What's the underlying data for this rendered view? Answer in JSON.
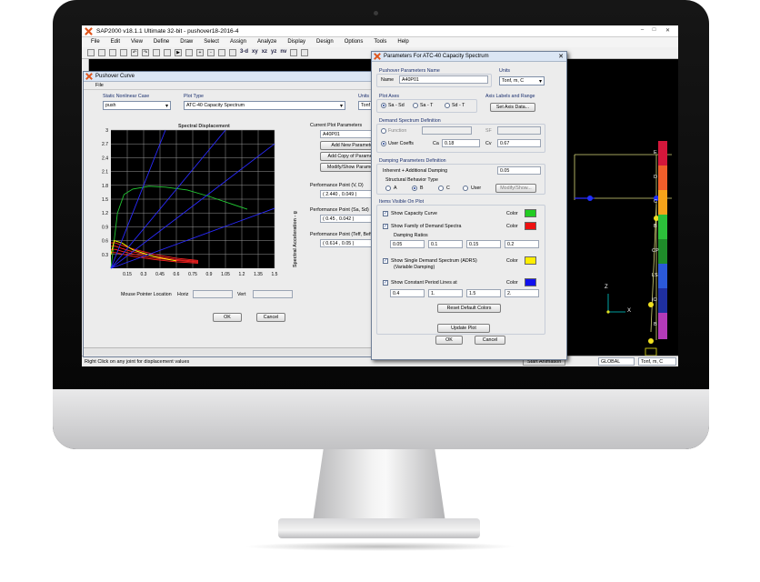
{
  "app": {
    "title": "SAP2000 v18.1.1 Ultimate 32-bit - pushover18-2016-4",
    "menu": [
      "File",
      "Edit",
      "View",
      "Define",
      "Draw",
      "Select",
      "Assign",
      "Analyze",
      "Display",
      "Design",
      "Options",
      "Tools",
      "Help"
    ],
    "toolbar_text": [
      "3-d",
      "xy",
      "xz",
      "yz",
      "nv"
    ],
    "status_text": "Right Click on any joint for displacement values",
    "status_animation": "Start Animation",
    "status_global": "GLOBAL",
    "status_units": "Tonf, m, C"
  },
  "pushover_curve": {
    "title": "Pushover Curve",
    "menu_file": "File",
    "case_label": "Static Nonlinear Case",
    "case_value": "push",
    "plot_type_label": "Plot Type",
    "plot_type_value": "ATC-40 Capacity Spectrum",
    "units_label": "Units",
    "units_value": "Tonf",
    "chart_title": "Spectral Displacement",
    "ylabel": "Spectral Acceleration - g",
    "current_params_label": "Current Plot Parameters",
    "current_params_value": "A40P01",
    "add_new_btn": "Add New Parameters",
    "add_copy_btn": "Add Copy of Parameters",
    "modify_btn": "Modify/Show Parameters",
    "perf_v_label": "Performance Point (V, D)",
    "perf_v_value": "( 2.440 , 0.049 )",
    "perf_sa_label": "Performance Point (Sa, Sd)",
    "perf_sa_value": "( 0.45 , 0.042 )",
    "perf_t_label": "Performance Point (Teff, Beff)",
    "perf_t_value": "( 0.614 , 0.05 )",
    "mouse_label": "Mouse Pointer Location",
    "horiz_label": "Horiz",
    "vert_label": "Vert",
    "ok": "OK",
    "cancel": "Cancel"
  },
  "chart_data": {
    "type": "line",
    "title": "Spectral Displacement",
    "ylabel": "Spectral Acceleration - g",
    "xlim": [
      0,
      1.5
    ],
    "ylim": [
      0,
      3
    ],
    "x_ticks": [
      "0.15",
      "0.3",
      "0.45",
      "0.6",
      "0.75",
      "0.9",
      "1.05",
      "1.2",
      "1.35",
      "1.5"
    ],
    "y_ticks": [
      "0.3",
      "0.6",
      "0.9",
      "1.2",
      "1.5",
      "1.8",
      "2.1",
      "2.4",
      "2.7",
      "3"
    ],
    "grid": true,
    "series": [
      {
        "color": "#22c833",
        "x": [
          0,
          0.06,
          0.12,
          0.2,
          0.35,
          0.5,
          0.7,
          0.9,
          1.1,
          1.25
        ],
        "y": [
          0,
          1.2,
          1.6,
          1.72,
          1.78,
          1.76,
          1.7,
          1.56,
          1.4,
          1.28
        ]
      },
      {
        "color": "#ff2222",
        "x": [
          0,
          0.04,
          0.1,
          0.2,
          0.4,
          0.6,
          0.8
        ],
        "y": [
          0.55,
          0.55,
          0.5,
          0.42,
          0.3,
          0.22,
          0.17
        ]
      },
      {
        "color": "#ff2222",
        "x": [
          0,
          0.04,
          0.1,
          0.2,
          0.4,
          0.6,
          0.8
        ],
        "y": [
          0.48,
          0.48,
          0.43,
          0.36,
          0.26,
          0.19,
          0.15
        ]
      },
      {
        "color": "#ff2222",
        "x": [
          0,
          0.04,
          0.1,
          0.2,
          0.4,
          0.6,
          0.8
        ],
        "y": [
          0.41,
          0.41,
          0.37,
          0.31,
          0.22,
          0.17,
          0.13
        ]
      },
      {
        "color": "#ff2222",
        "x": [
          0,
          0.04,
          0.1,
          0.2,
          0.4,
          0.6,
          0.8
        ],
        "y": [
          0.34,
          0.34,
          0.31,
          0.26,
          0.19,
          0.14,
          0.11
        ]
      },
      {
        "color": "#ffff00",
        "x": [
          0,
          0.03,
          0.1,
          0.2,
          0.4,
          0.6
        ],
        "y": [
          0.3,
          0.6,
          0.55,
          0.4,
          0.25,
          0.16
        ]
      },
      {
        "color": "#2a2aff",
        "x": [
          0,
          0.5
        ],
        "y": [
          0,
          3
        ]
      },
      {
        "color": "#2a2aff",
        "x": [
          0,
          1.05
        ],
        "y": [
          0,
          3
        ]
      },
      {
        "color": "#2a2aff",
        "x": [
          0,
          1.5
        ],
        "y": [
          0,
          2.7
        ]
      },
      {
        "color": "#2a2aff",
        "x": [
          0,
          1.5
        ],
        "y": [
          0,
          1.3
        ]
      }
    ]
  },
  "params_dialog": {
    "title": "Parameters For ATC-40 Capacity Spectrum",
    "name_group": "Pushover Parameters Name",
    "name_label": "Name",
    "name_value": "A40P01",
    "units_label": "Units",
    "units_value": "Tonf, m, C",
    "plot_axes_label": "Plot Axes",
    "axes_options": [
      "Sa - Sd",
      "Sa - T",
      "Sd - T"
    ],
    "axis_labels_label": "Axis Labels and Range",
    "set_axis_btn": "Set Axis Data...",
    "demand_label": "Demand Spectrum Definition",
    "function_label": "Function",
    "user_coeffs_label": "User Coeffs",
    "sf_label": "SF",
    "ca_label": "Ca",
    "ca_value": "0.18",
    "cv_label": "Cv",
    "cv_value": "0.67",
    "damping_label": "Damping Parameters Definition",
    "inherent_label": "Inherent + Additional Damping",
    "inherent_value": "0.05",
    "struct_label": "Structural Behavior Type",
    "struct_options": [
      "A",
      "B",
      "C",
      "User"
    ],
    "modify_show_btn": "Modify/Show...",
    "items_label": "Items Visible On Plot",
    "show_capacity": "Show Capacity Curve",
    "show_family": "Show Family of Demand Spectra",
    "damping_ratios_label": "Damping Ratios",
    "damping_ratios": [
      "0.05",
      "0.1",
      "0.15",
      "0.2"
    ],
    "show_single": "Show Single Demand Spectrum (ADRS)",
    "variable_damping": "(Variable Damping)",
    "show_periods": "Show Constant Period Lines at",
    "periods": [
      "0.4",
      "1.",
      "1.5",
      "2."
    ],
    "color_label": "Color",
    "colors": {
      "capacity": "#22cc22",
      "family": "#ee1111",
      "single": "#ffee00",
      "periods": "#1111ee"
    },
    "reset_btn": "Reset Default Colors",
    "update_btn": "Update Plot",
    "ok": "OK",
    "cancel": "Cancel"
  },
  "model_view": {
    "level_labels": [
      "E",
      "D",
      "C",
      "B",
      "CP",
      "LS",
      "IO",
      "B"
    ],
    "level_colors": [
      "#d4173b",
      "#f05e2a",
      "#f5a31a",
      "#2cc03a",
      "#1f8c2a",
      "#2b59d8",
      "#1f2fa0",
      "#b33ab8"
    ],
    "axis_x": "X",
    "axis_z": "Z"
  }
}
